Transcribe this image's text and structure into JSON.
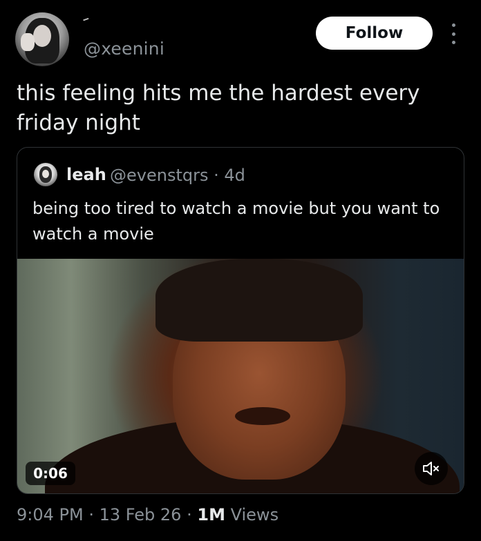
{
  "author": {
    "handle": "@xeenini",
    "avatar_icon": "profile-avatar"
  },
  "follow_button": {
    "label": "Follow"
  },
  "more_icon": "more-options-icon",
  "tweet": {
    "text": "this feeling hits me the hardest every friday night"
  },
  "quoted_tweet": {
    "display_name": "leah",
    "handle": "@evenstqrs",
    "separator": "·",
    "age": "4d",
    "text": "being too tired to watch a movie but you want to watch a movie",
    "video": {
      "duration_label": "0:06",
      "mute_icon": "volume-muted-icon"
    }
  },
  "footer": {
    "time": "9:04 PM",
    "sep1": "·",
    "date": "13 Feb 26",
    "sep2": "·",
    "views_count": "1M",
    "views_label": "Views"
  },
  "colors": {
    "background": "#000000",
    "text_primary": "#e7e9ea",
    "text_secondary": "#8b9298",
    "border": "#2f3336",
    "follow_bg": "#ffffff"
  }
}
